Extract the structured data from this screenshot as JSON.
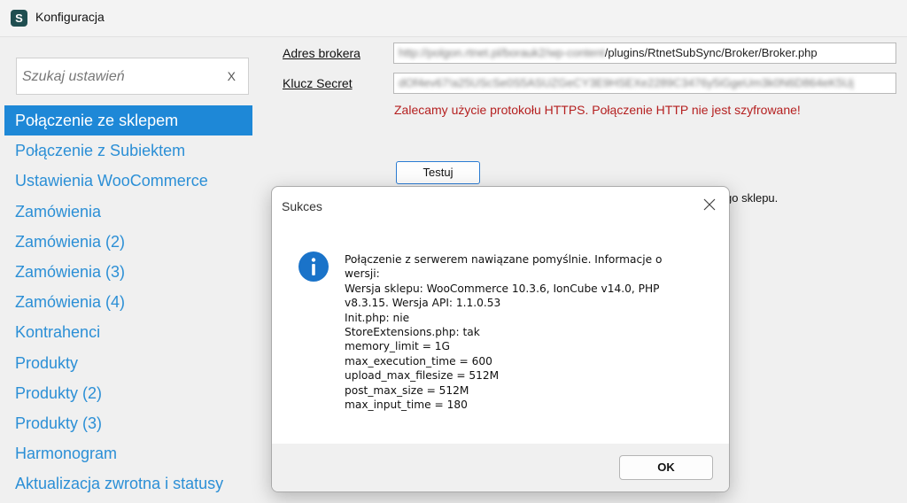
{
  "window": {
    "title": "Konfiguracja",
    "icon_letter": "S",
    "icon_color": "#1f4e50"
  },
  "sidebar": {
    "search_placeholder": "Szukaj ustawień",
    "search_clear": "X",
    "items": [
      {
        "label": "Połączenie ze sklepem",
        "selected": true
      },
      {
        "label": "Połączenie z Subiektem"
      },
      {
        "label": "Ustawienia WooCommerce"
      },
      {
        "label": "Zamówienia"
      },
      {
        "label": "Zamówienia (2)"
      },
      {
        "label": "Zamówienia (3)"
      },
      {
        "label": "Zamówienia (4)"
      },
      {
        "label": "Kontrahenci"
      },
      {
        "label": "Produkty"
      },
      {
        "label": "Produkty (2)"
      },
      {
        "label": "Produkty (3)"
      },
      {
        "label": "Harmonogram"
      },
      {
        "label": "Aktualizacja zwrotna i statusy"
      }
    ]
  },
  "main": {
    "broker_label": "Adres brokera",
    "broker_value_prefix": "http://polgon.rtnet.pl/borauk2/wp-content",
    "broker_value_suffix": "/plugins/RtnetSubSync/Broker/Broker.php",
    "secret_label": "Klucz Secret",
    "secret_value": "dOf4ev67!a25UScSe0S5ASUZGeCY3E9HSEXe2289C3476y5iGgeUm3k0N6D864eK5Uj",
    "warning": "Zalecamy użycie protokołu HTTPS. Połączenie HTTP nie jest szyfrowane!",
    "test_button": "Testuj",
    "behind_text": "go sklepu."
  },
  "dialog": {
    "title": "Sukces",
    "message_lines": [
      "Połączenie z serwerem nawiązane pomyślnie. Informacje o",
      "wersji:",
      "Wersja sklepu: WooCommerce 10.3.6, IonCube v14.0, PHP",
      "v8.3.15. Wersja API: 1.1.0.53",
      "Init.php: nie",
      "StoreExtensions.php: tak",
      "memory_limit = 1G",
      "max_execution_time = 600",
      "upload_max_filesize = 512M",
      "post_max_size = 512M",
      "max_input_time = 180"
    ],
    "ok_button": "OK"
  },
  "colors": {
    "accent": "#1e88d7",
    "link": "#2b8fd6",
    "warning": "#b52020"
  }
}
